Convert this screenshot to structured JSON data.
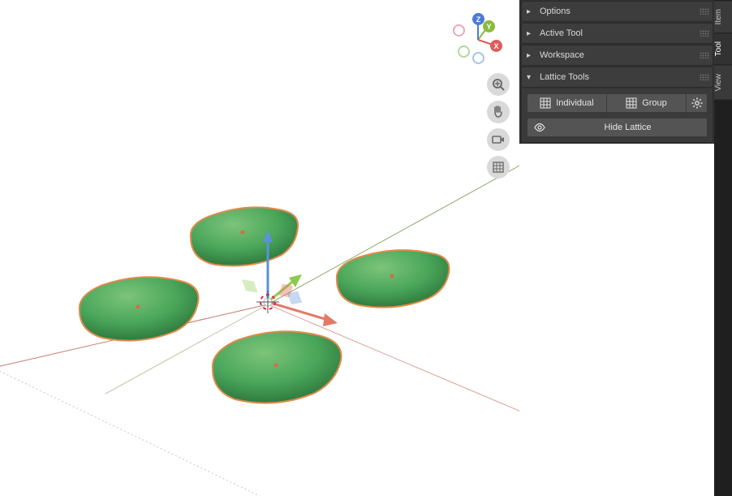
{
  "nav_gizmo": {
    "axes": {
      "x": "X",
      "y": "Y",
      "z": "Z"
    }
  },
  "viewport_buttons": [
    {
      "name": "zoom-icon"
    },
    {
      "name": "pan-icon"
    },
    {
      "name": "camera-icon"
    },
    {
      "name": "ortho-icon"
    }
  ],
  "panels": {
    "options": {
      "title": "Options",
      "expanded": false
    },
    "active_tool": {
      "title": "Active Tool",
      "expanded": false
    },
    "workspace": {
      "title": "Workspace",
      "expanded": false
    },
    "lattice_tools": {
      "title": "Lattice Tools",
      "expanded": true,
      "buttons": {
        "individual": "Individual",
        "group": "Group",
        "hide_lattice": "Hide Lattice"
      }
    }
  },
  "tabs": [
    {
      "id": "item",
      "label": "Item",
      "active": false
    },
    {
      "id": "tool",
      "label": "Tool",
      "active": true
    },
    {
      "id": "view",
      "label": "View",
      "active": false
    }
  ],
  "scene": {
    "objects": [
      {
        "name": "pillow-1",
        "selected": true
      },
      {
        "name": "pillow-2",
        "selected": true
      },
      {
        "name": "pillow-3",
        "selected": true
      },
      {
        "name": "pillow-4",
        "selected": true
      }
    ],
    "axis_colors": {
      "x": "#d85b5b",
      "y": "#6fa34a",
      "z": "#4a7bd8"
    },
    "pillow_color": "#4aa65a",
    "pillow_outline": "#e08a4a"
  }
}
